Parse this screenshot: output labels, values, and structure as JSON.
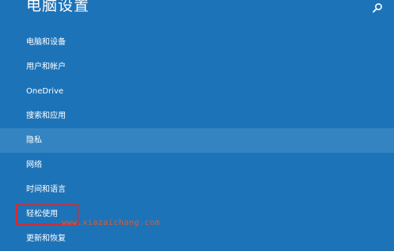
{
  "header": {
    "title": "电脑设置",
    "search_icon": "search-icon"
  },
  "nav": {
    "selected_index": 4,
    "items": [
      {
        "label": "电脑和设备"
      },
      {
        "label": "用户和帐户"
      },
      {
        "label": "OneDrive"
      },
      {
        "label": "搜索和应用"
      },
      {
        "label": "隐私"
      },
      {
        "label": "网络"
      },
      {
        "label": "时间和语言"
      },
      {
        "label": "轻松使用"
      },
      {
        "label": "更新和恢复"
      }
    ]
  },
  "annotation": {
    "highlighted_item": "轻松使用",
    "color": "#e0262a"
  },
  "watermark": {
    "text": "www.xiazaichang.com"
  },
  "colors": {
    "background": "#1d73b8",
    "selected_background": "#3484c1",
    "text": "#ffffff"
  }
}
